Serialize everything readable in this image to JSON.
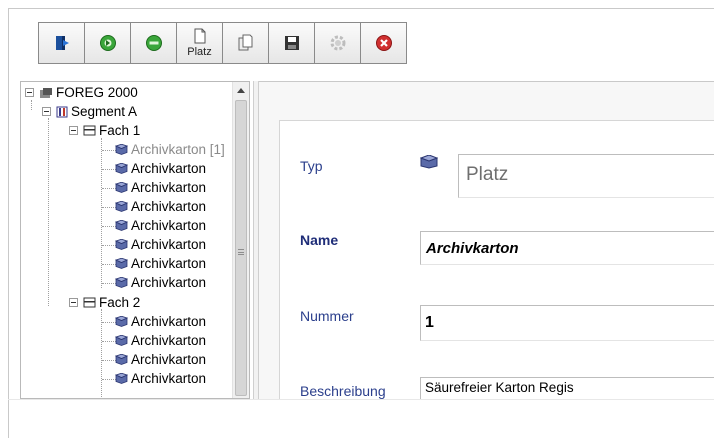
{
  "toolbar": {
    "buttons": [
      {
        "icon": "exit-door-icon"
      },
      {
        "icon": "add-green-icon"
      },
      {
        "icon": "remove-green-icon"
      },
      {
        "icon": "new-place-icon",
        "label": "Platz"
      },
      {
        "icon": "copy-icon"
      },
      {
        "icon": "save-icon"
      },
      {
        "icon": "settings-gear-icon"
      },
      {
        "icon": "cancel-red-icon"
      }
    ]
  },
  "tree": {
    "root": {
      "label": "FOREG 2000"
    },
    "segment": {
      "label": "Segment A"
    },
    "fach1": {
      "label": "Fach 1",
      "items": [
        "Archivkarton [1]",
        "Archivkarton",
        "Archivkarton",
        "Archivkarton",
        "Archivkarton",
        "Archivkarton",
        "Archivkarton",
        "Archivkarton"
      ]
    },
    "fach2": {
      "label": "Fach 2",
      "items": [
        "Archivkarton",
        "Archivkarton",
        "Archivkarton",
        "Archivkarton"
      ]
    }
  },
  "form": {
    "typ": {
      "label": "Typ",
      "value": "Platz"
    },
    "name": {
      "label": "Name",
      "value": "Archivkarton"
    },
    "nummer": {
      "label": "Nummer",
      "value": "1"
    },
    "beschreibung": {
      "label": "Beschreibung",
      "value": "Säurefreier Karton Regis"
    }
  },
  "colors": {
    "label_blue": "#2b3f8c",
    "green_button": "#3aa63a",
    "red_button": "#d03030"
  }
}
